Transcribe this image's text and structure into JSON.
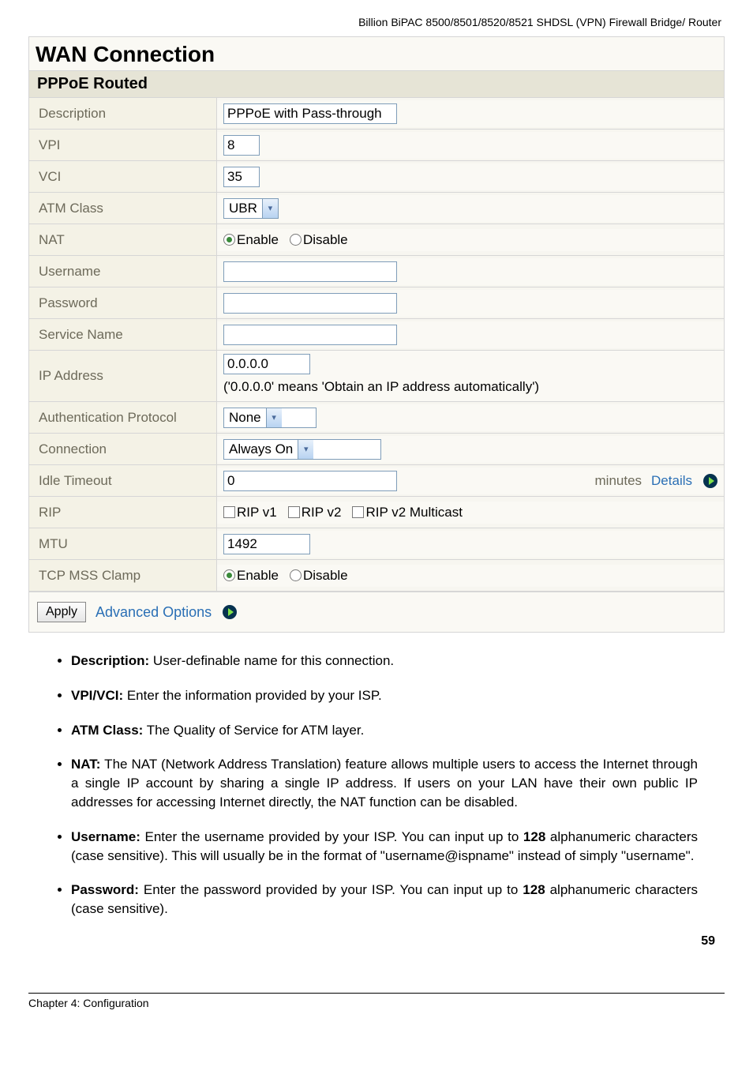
{
  "header": "Billion BiPAC 8500/8501/8520/8521 SHDSL (VPN) Firewall Bridge/ Router",
  "panel": {
    "title": "WAN Connection",
    "subtitle": "PPPoE Routed"
  },
  "fields": {
    "description": {
      "label": "Description",
      "value": "PPPoE with Pass-through"
    },
    "vpi": {
      "label": "VPI",
      "value": "8"
    },
    "vci": {
      "label": "VCI",
      "value": "35"
    },
    "atm": {
      "label": "ATM Class",
      "value": "UBR"
    },
    "nat": {
      "label": "NAT",
      "enable": "Enable",
      "disable": "Disable"
    },
    "username": {
      "label": "Username",
      "value": ""
    },
    "password": {
      "label": "Password",
      "value": ""
    },
    "service": {
      "label": "Service Name",
      "value": ""
    },
    "ip": {
      "label": "IP Address",
      "value": "0.0.0.0",
      "note": "('0.0.0.0' means 'Obtain an IP address automatically')"
    },
    "auth": {
      "label": "Authentication Protocol",
      "value": "None"
    },
    "connection": {
      "label": "Connection",
      "value": "Always On"
    },
    "idle": {
      "label": "Idle Timeout",
      "value": "0",
      "minutes": "minutes",
      "details": "Details"
    },
    "rip": {
      "label": "RIP",
      "v1": "RIP v1",
      "v2": "RIP v2",
      "mc": "RIP v2 Multicast"
    },
    "mtu": {
      "label": "MTU",
      "value": "1492"
    },
    "tcp": {
      "label": "TCP MSS Clamp",
      "enable": "Enable",
      "disable": "Disable"
    }
  },
  "footer": {
    "apply": "Apply",
    "advanced": "Advanced Options"
  },
  "bullets": {
    "b1_label": "Description:",
    "b1_text": " User-definable name for this connection.",
    "b2_label": "VPI/VCI:",
    "b2_text": " Enter the information provided by your ISP.",
    "b3_label": "ATM Class:",
    "b3_text": " The Quality of Service for ATM layer.",
    "b4_label": "NAT:",
    "b4_text": " The NAT (Network Address Translation) feature allows multiple users to access the Internet through a single IP account by sharing a single IP address. If users on your LAN have their own public IP addresses for accessing Internet directly, the NAT function can be disabled.",
    "b5_label": "Username:",
    "b5_text": " Enter the username provided by your ISP. You can input up to ",
    "b5_num": "128",
    "b5_text2": " alphanumeric characters (case sensitive). This will usually be in the format of \"username@ispname\" instead of simply \"username\".",
    "b6_label": "Password:",
    "b6_text": " Enter the password provided by your ISP. You can input up to ",
    "b6_num": "128",
    "b6_text2": " alphanumeric characters (case sensitive)."
  },
  "pagefooter": {
    "chapter": "Chapter 4: Configuration",
    "page": "59"
  }
}
